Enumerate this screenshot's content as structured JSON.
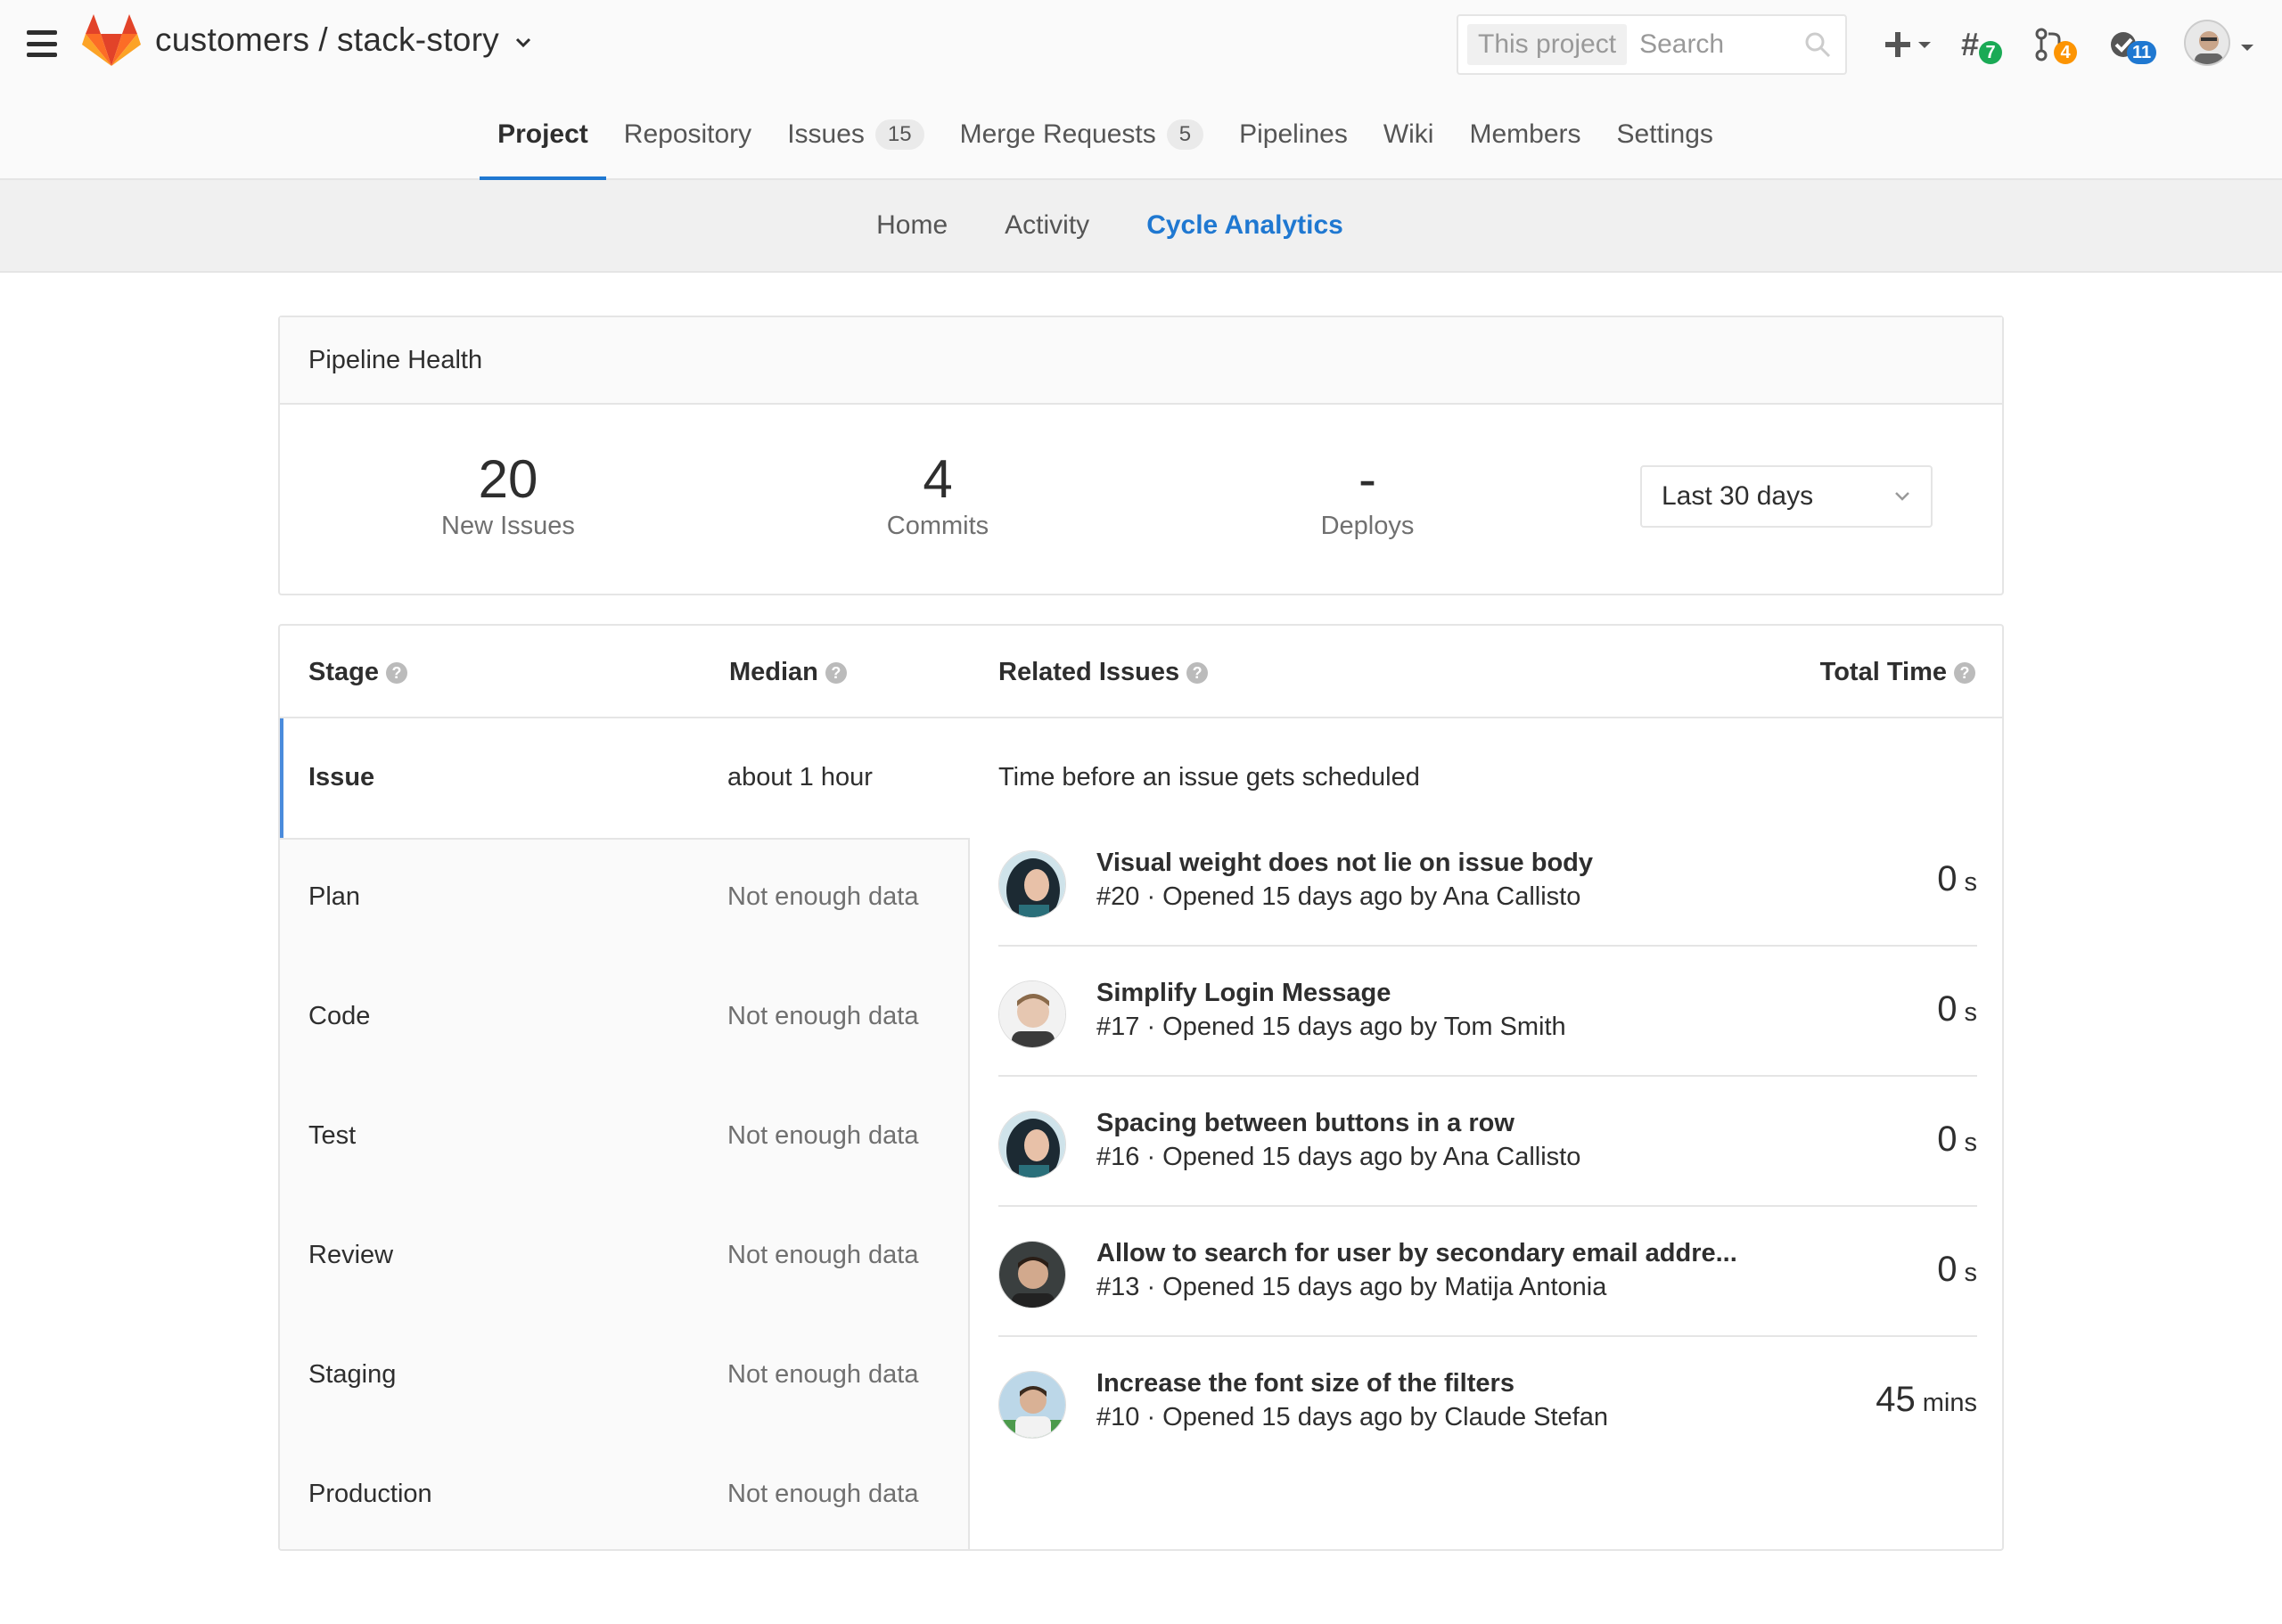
{
  "header": {
    "namespace": "customers",
    "separator": "/",
    "project": "stack-story",
    "search_scope": "This project",
    "search_placeholder": "Search",
    "issues_badge": "7",
    "mr_badge": "4",
    "todos_badge": "11"
  },
  "project_nav": {
    "items": [
      {
        "label": "Project"
      },
      {
        "label": "Repository"
      },
      {
        "label": "Issues",
        "count": "15"
      },
      {
        "label": "Merge Requests",
        "count": "5"
      },
      {
        "label": "Pipelines"
      },
      {
        "label": "Wiki"
      },
      {
        "label": "Members"
      },
      {
        "label": "Settings"
      }
    ]
  },
  "sub_nav": {
    "items": [
      {
        "label": "Home"
      },
      {
        "label": "Activity"
      },
      {
        "label": "Cycle Analytics"
      }
    ]
  },
  "pipeline_health": {
    "title": "Pipeline Health",
    "stats": [
      {
        "value": "20",
        "label": "New Issues"
      },
      {
        "value": "4",
        "label": "Commits"
      },
      {
        "value": "-",
        "label": "Deploys"
      }
    ],
    "range": "Last 30 days"
  },
  "stages_table": {
    "headers": {
      "stage": "Stage",
      "median": "Median",
      "related": "Related Issues",
      "total": "Total Time"
    },
    "stages": [
      {
        "name": "Issue",
        "median": "about 1 hour"
      },
      {
        "name": "Plan",
        "median": "Not enough data"
      },
      {
        "name": "Code",
        "median": "Not enough data"
      },
      {
        "name": "Test",
        "median": "Not enough data"
      },
      {
        "name": "Review",
        "median": "Not enough data"
      },
      {
        "name": "Staging",
        "median": "Not enough data"
      },
      {
        "name": "Production",
        "median": "Not enough data"
      }
    ],
    "description": "Time before an issue gets scheduled",
    "issues": [
      {
        "title": "Visual weight does not lie on issue body",
        "ref": "#20",
        "opened": "Opened 15 days ago by",
        "author": "Ana Callisto",
        "time": "0",
        "unit": "s"
      },
      {
        "title": "Simplify Login Message",
        "ref": "#17",
        "opened": "Opened 15 days ago by",
        "author": "Tom Smith",
        "time": "0",
        "unit": "s"
      },
      {
        "title": "Spacing between buttons in a row",
        "ref": "#16",
        "opened": "Opened 15 days ago by",
        "author": "Ana Callisto",
        "time": "0",
        "unit": "s"
      },
      {
        "title": "Allow to search for user by secondary email addre...",
        "ref": "#13",
        "opened": "Opened 15 days ago by",
        "author": "Matija Antonia",
        "time": "0",
        "unit": "s"
      },
      {
        "title": "Increase the font size of the filters",
        "ref": "#10",
        "opened": "Opened 15 days ago by",
        "author": "Claude Stefan",
        "time": "45",
        "unit": "mins"
      }
    ]
  },
  "colors": {
    "accent": "#1f78d1",
    "active_stage_border": "#4a8bdc",
    "badge_green": "#1aaa55",
    "badge_orange": "#fc9403",
    "badge_blue": "#1f78d1"
  },
  "icons": [
    "menu-icon",
    "gitlab-logo",
    "chevron-down-icon",
    "search-icon",
    "plus-icon",
    "issues-icon",
    "merge-request-icon",
    "todo-icon",
    "help-icon"
  ]
}
